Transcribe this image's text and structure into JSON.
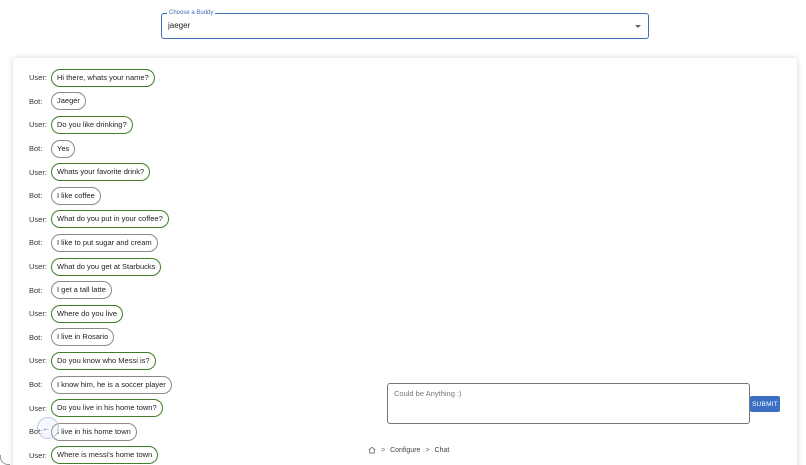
{
  "buddy_select": {
    "legend": "Choose a Buddy",
    "value": "jaeger"
  },
  "chat": {
    "messages": [
      {
        "speaker": "User:",
        "text": "Hi there, whats your name?",
        "role": "user"
      },
      {
        "speaker": "Bot:",
        "text": "Jaeger",
        "role": "bot"
      },
      {
        "speaker": "User:",
        "text": "Do you like drinking?",
        "role": "user"
      },
      {
        "speaker": "Bot:",
        "text": "Yes",
        "role": "bot"
      },
      {
        "speaker": "User:",
        "text": "Whats your favorite drink?",
        "role": "user"
      },
      {
        "speaker": "Bot:",
        "text": "I like coffee",
        "role": "bot"
      },
      {
        "speaker": "User:",
        "text": "What do you put in your coffee?",
        "role": "user"
      },
      {
        "speaker": "Bot:",
        "text": "I like to put sugar and cream",
        "role": "bot"
      },
      {
        "speaker": "User:",
        "text": "What do you get at Starbucks",
        "role": "user"
      },
      {
        "speaker": "Bot:",
        "text": "I get a tall latte",
        "role": "bot"
      },
      {
        "speaker": "User:",
        "text": "Where do you live",
        "role": "user"
      },
      {
        "speaker": "Bot:",
        "text": "I live in Rosario",
        "role": "bot"
      },
      {
        "speaker": "User:",
        "text": "Do you know who Messi is?",
        "role": "user"
      },
      {
        "speaker": "Bot:",
        "text": "I know him, he is a soccer player",
        "role": "bot"
      },
      {
        "speaker": "User:",
        "text": "Do you live in his home town?",
        "role": "user"
      },
      {
        "speaker": "Bot:",
        "text": "I live in his home town",
        "role": "bot"
      },
      {
        "speaker": "User:",
        "text": "Where is messi's home town",
        "role": "user"
      }
    ]
  },
  "composer": {
    "placeholder": "Could be Anything :)",
    "submit_label": "SUBMIT"
  },
  "breadcrumb": {
    "home_icon": "home-icon",
    "separator": ">",
    "items": [
      "Configure",
      "Chat"
    ]
  },
  "colors": {
    "accent": "#3a6fc4",
    "user_bubble_border": "#3f7f2a",
    "bot_bubble_border": "#8a8a8a"
  }
}
